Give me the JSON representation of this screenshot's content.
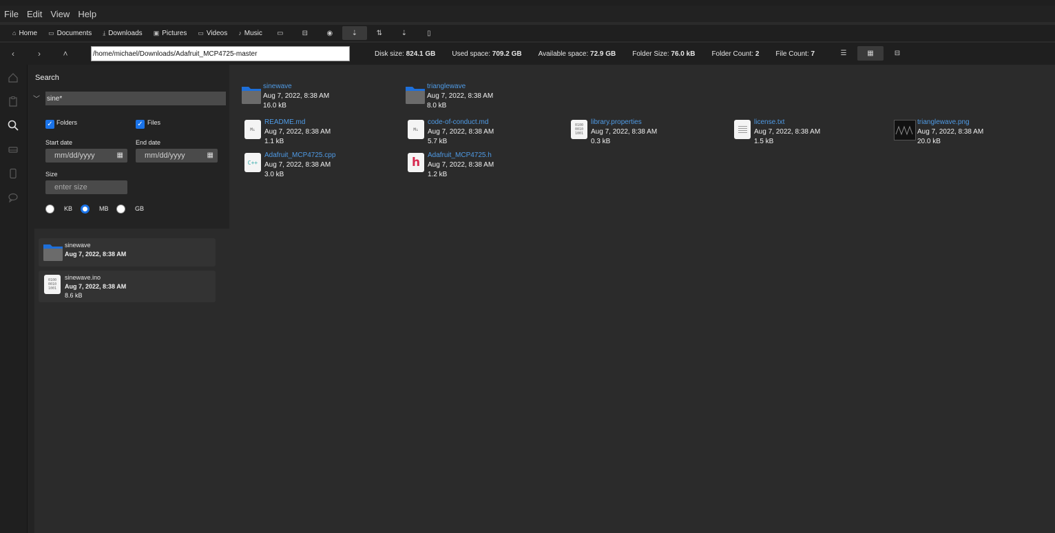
{
  "menu": [
    "File",
    "Edit",
    "View",
    "Help"
  ],
  "toolbar": {
    "places": [
      {
        "label": "Home",
        "icon": "home-icon",
        "glyph": "⌂"
      },
      {
        "label": "Documents",
        "icon": "documents-icon",
        "glyph": "▭"
      },
      {
        "label": "Downloads",
        "icon": "downloads-icon",
        "glyph": "⤓"
      },
      {
        "label": "Pictures",
        "icon": "pictures-icon",
        "glyph": "▣"
      },
      {
        "label": "Videos",
        "icon": "videos-icon",
        "glyph": "▭"
      },
      {
        "label": "Music",
        "icon": "music-icon",
        "glyph": "♪"
      }
    ],
    "actions": [
      "terminal-icon",
      "drive-icon",
      "eye-icon",
      "sort-desc-icon",
      "sort-toggle-icon",
      "sort-asc-icon",
      "file-icon"
    ]
  },
  "address": {
    "path": "/home/michael/Downloads/Adafruit_MCP4725-master",
    "stats": [
      {
        "label": "Disk size:",
        "value": "824.1 GB"
      },
      {
        "label": "Used space:",
        "value": "709.2 GB"
      },
      {
        "label": "Available space:",
        "value": "72.9 GB"
      },
      {
        "label": "Folder Size:",
        "value": "76.0 kB"
      },
      {
        "label": "Folder Count:",
        "value": "2"
      },
      {
        "label": "File Count:",
        "value": "7"
      }
    ]
  },
  "search": {
    "title": "Search",
    "query": "sine*",
    "folders_label": "Folders",
    "files_label": "Files",
    "folders_checked": true,
    "files_checked": true,
    "start_label": "Start date",
    "end_label": "End date",
    "date_placeholder": "mm/dd/yyyy",
    "size_label": "Size",
    "size_placeholder": "enter size",
    "units": [
      "KB",
      "MB",
      "GB"
    ],
    "selected_unit": "MB",
    "results": [
      {
        "name": "sinewave",
        "type": "folder",
        "date": "Aug 7, 2022, 8:38 AM",
        "size": ""
      },
      {
        "name": "sinewave.ino",
        "type": "binary",
        "date": "Aug 7, 2022, 8:38 AM",
        "size": "8.6 kB"
      }
    ]
  },
  "files": [
    {
      "name": "sinewave",
      "type": "folder",
      "date": "Aug 7, 2022, 8:38 AM",
      "size": "16.0 kB"
    },
    {
      "name": "trianglewave",
      "type": "folder",
      "date": "Aug 7, 2022, 8:38 AM",
      "size": "8.0 kB"
    },
    {
      "name": "README.md",
      "type": "markdown",
      "date": "Aug 7, 2022, 8:38 AM",
      "size": "1.1 kB"
    },
    {
      "name": "code-of-conduct.md",
      "type": "markdown",
      "date": "Aug 7, 2022, 8:38 AM",
      "size": "5.7 kB"
    },
    {
      "name": "library.properties",
      "type": "binary",
      "date": "Aug 7, 2022, 8:38 AM",
      "size": "0.3 kB"
    },
    {
      "name": "license.txt",
      "type": "text",
      "date": "Aug 7, 2022, 8:38 AM",
      "size": "1.5 kB"
    },
    {
      "name": "trianglewave.png",
      "type": "image",
      "date": "Aug 7, 2022, 8:38 AM",
      "size": "20.0 kB"
    },
    {
      "name": "Adafruit_MCP4725.cpp",
      "type": "cpp",
      "date": "Aug 7, 2022, 8:38 AM",
      "size": "3.0 kB"
    },
    {
      "name": "Adafruit_MCP4725.h",
      "type": "header",
      "date": "Aug 7, 2022, 8:38 AM",
      "size": "1.2 kB"
    }
  ],
  "colors": {
    "accent": "#1a73e8",
    "link": "#4f9be6",
    "folder_top": "#1e6fd9",
    "folder_body": "#6b6b6b"
  }
}
